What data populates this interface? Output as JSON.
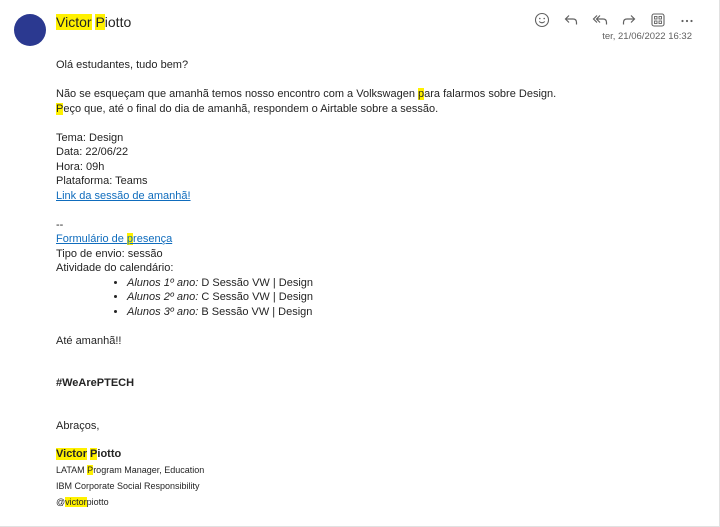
{
  "sender": {
    "name_hl1": "Victor",
    "name_sp": " ",
    "name_hl2": "P",
    "name_rest": "iotto"
  },
  "date": "ter, 21/06/2022 16:32",
  "toolbar": {
    "emoji": "emoji-icon",
    "reply": "reply-icon",
    "reply_all": "reply-all-icon",
    "forward": "forward-icon",
    "apps": "apps-icon",
    "more": "more-icon"
  },
  "body": {
    "greeting": "Olá estudantes, tudo bem?",
    "line1_a": "Não se esqueçam que amanhã temos nosso encontro com a Volkswagen ",
    "line1_hl": "p",
    "line1_b": "ara falarmos sobre Design.",
    "line2_hl": "P",
    "line2_b": "eço que, até o final do dia de amanhã, respondem o Airtable sobre a sessão.",
    "tema": "Tema: Design",
    "data": "Data: 22/06/22",
    "hora": "Hora: 09h",
    "plataforma": "Plataforma: Teams",
    "link": "Link da sessão de amanhã!",
    "dashes": "--",
    "form_a": "Formulário de ",
    "form_hl": "p",
    "form_b": "resença",
    "tipo": "Tipo de envio: sessão",
    "atividade": "Atividade do calendário:",
    "items": [
      {
        "label": "Alunos 1º ano:",
        "text": " D Sessão VW | Design"
      },
      {
        "label": "Alunos 2º ano:",
        "text": " C Sessão VW | Design"
      },
      {
        "label": "Alunos 3º ano:",
        "text": " B Sessão VW | Design"
      }
    ],
    "ate": "Até amanhã!!",
    "hashtag": "#WeArePTECH",
    "abracos": "Abraços,",
    "sig_hl1": "Victor",
    "sig_hl2": "P",
    "sig_rest": "iotto",
    "role_a": "LATAM ",
    "role_hl": "P",
    "role_b": "rogram Manager, Education",
    "org": "IBM Corporate Social Responsibility",
    "handle_a": "@",
    "handle_hl": "victor",
    "handle_b": "piotto"
  }
}
